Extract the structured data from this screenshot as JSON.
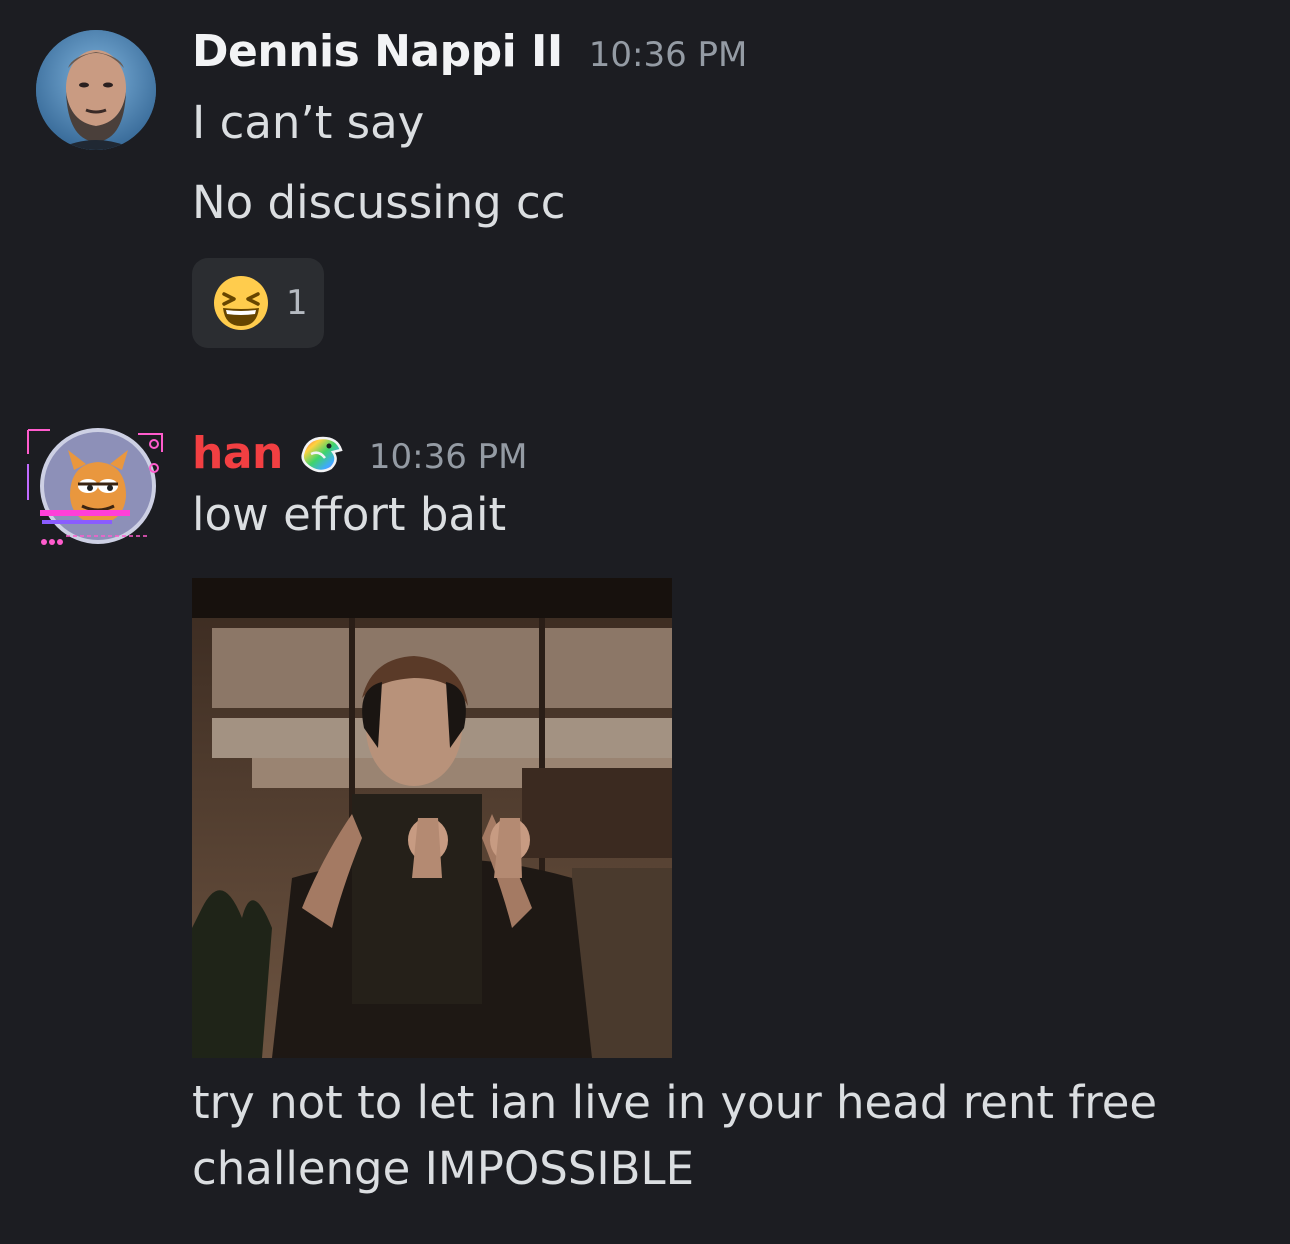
{
  "messages": [
    {
      "author": "Dennis Nappi II",
      "author_color": "#f2f3f5",
      "timestamp": "10:36 PM",
      "lines": [
        "I can’t say",
        "No discussing cc"
      ],
      "reactions": [
        {
          "emoji": "laughing-squinting-face",
          "count": "1"
        }
      ]
    },
    {
      "author": "han",
      "author_color": "#f23f42",
      "badge_icon": "rainbow-bird-icon",
      "timestamp": "10:36 PM",
      "text": "low effort bait",
      "attachment": {
        "type": "gif",
        "subject": "man-dancing-with-headphones"
      },
      "caption_lines": [
        "try not to let ian live in your head rent free",
        "challenge IMPOSSIBLE"
      ]
    }
  ]
}
